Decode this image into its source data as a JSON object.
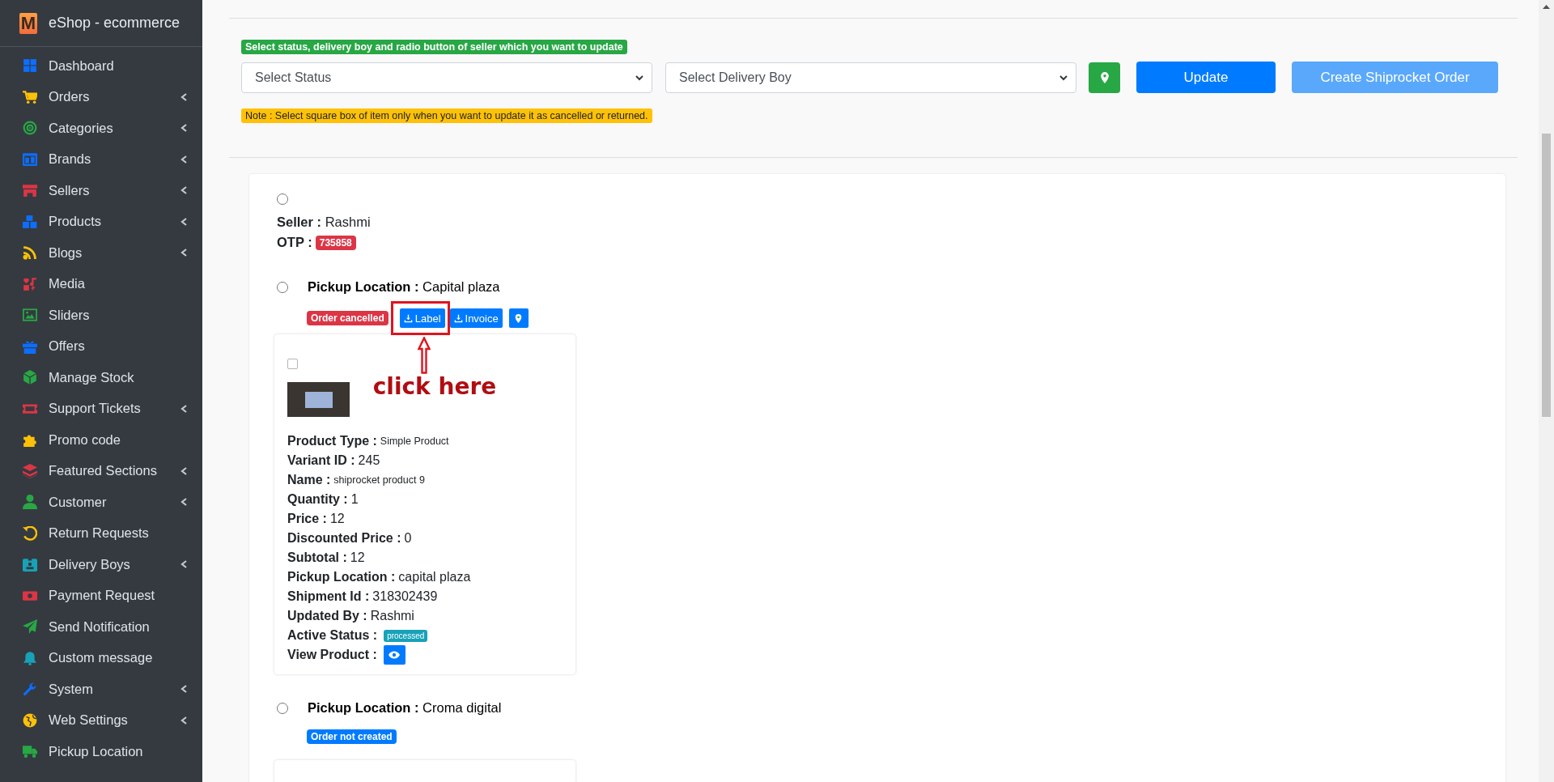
{
  "sidebar": {
    "brand": {
      "logo": "M",
      "title": "eShop - ecommerce"
    },
    "items": [
      {
        "label": "Dashboard",
        "color": "#0d6efd",
        "expandable": false
      },
      {
        "label": "Orders",
        "color": "#ffc107",
        "expandable": true
      },
      {
        "label": "Categories",
        "color": "#28a745",
        "expandable": true
      },
      {
        "label": "Brands",
        "color": "#0d6efd",
        "expandable": true
      },
      {
        "label": "Sellers",
        "color": "#dc3545",
        "expandable": true
      },
      {
        "label": "Products",
        "color": "#0d6efd",
        "expandable": true
      },
      {
        "label": "Blogs",
        "color": "#ffc107",
        "expandable": true
      },
      {
        "label": "Media",
        "color": "#dc3545",
        "expandable": false
      },
      {
        "label": "Sliders",
        "color": "#28a745",
        "expandable": false
      },
      {
        "label": "Offers",
        "color": "#0d6efd",
        "expandable": false
      },
      {
        "label": "Manage Stock",
        "color": "#28a745",
        "expandable": false
      },
      {
        "label": "Support Tickets",
        "color": "#dc3545",
        "expandable": true
      },
      {
        "label": "Promo code",
        "color": "#ffc107",
        "expandable": false
      },
      {
        "label": "Featured Sections",
        "color": "#dc3545",
        "expandable": true
      },
      {
        "label": "Customer",
        "color": "#28a745",
        "expandable": true
      },
      {
        "label": "Return Requests",
        "color": "#ffc107",
        "expandable": false
      },
      {
        "label": "Delivery Boys",
        "color": "#17a2b8",
        "expandable": true
      },
      {
        "label": "Payment Request",
        "color": "#dc3545",
        "expandable": false
      },
      {
        "label": "Send Notification",
        "color": "#28a745",
        "expandable": false
      },
      {
        "label": "Custom message",
        "color": "#17a2b8",
        "expandable": false
      },
      {
        "label": "System",
        "color": "#0d6efd",
        "expandable": true
      },
      {
        "label": "Web Settings",
        "color": "#ffc107",
        "expandable": true
      },
      {
        "label": "Pickup Location",
        "color": "#28a745",
        "expandable": false
      }
    ]
  },
  "toolbar": {
    "hint": "Select status, delivery boy and radio button of seller which you want to update",
    "status_select": {
      "placeholder": "Select Status"
    },
    "delivery_select": {
      "placeholder": "Select Delivery Boy"
    },
    "update_button": "Update",
    "shiprocket_button": "Create Shiprocket Order",
    "note": "Note : Select square box of item only when you want to update it as cancelled or returned."
  },
  "seller": {
    "selected": false,
    "seller_label": "Seller :",
    "seller_name": "Rashmi",
    "otp_label": "OTP :",
    "otp": "735858"
  },
  "pickups": [
    {
      "selected": false,
      "label": "Pickup Location :",
      "value": "Capital plaza",
      "status": {
        "text": "Order cancelled",
        "kind": "danger"
      },
      "actions": [
        "Label",
        "Invoice"
      ],
      "location_button": true,
      "callout": {
        "text": "click here"
      },
      "items": [
        {
          "checked": false,
          "fields": [
            {
              "label": "Product Type :",
              "value": "Simple Product",
              "kind": "small"
            },
            {
              "label": "Variant ID :",
              "value": "245",
              "kind": "text"
            },
            {
              "label": "Name :",
              "value": "shiprocket product 9",
              "kind": "small"
            },
            {
              "label": "Quantity :",
              "value": "1",
              "kind": "text"
            },
            {
              "label": "Price :",
              "value": "12",
              "kind": "text"
            },
            {
              "label": "Discounted Price :",
              "value": "0",
              "kind": "text"
            },
            {
              "label": "Subtotal :",
              "value": "12",
              "kind": "text"
            },
            {
              "label": "Pickup Location :",
              "value": "capital plaza",
              "kind": "text"
            },
            {
              "label": "Shipment Id :",
              "value": "318302439",
              "kind": "text"
            },
            {
              "label": "Updated By :",
              "value": "Rashmi",
              "kind": "text"
            },
            {
              "label": "Active Status :",
              "value": "processed",
              "kind": "badge"
            },
            {
              "label": "View Product :",
              "kind": "eye"
            }
          ]
        }
      ]
    },
    {
      "selected": false,
      "label": "Pickup Location :",
      "value": "Croma digital",
      "status": {
        "text": "Order not created",
        "kind": "primary"
      },
      "more_card": true
    }
  ]
}
